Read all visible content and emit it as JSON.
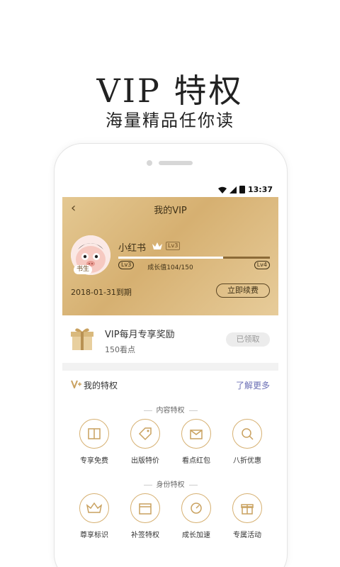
{
  "promo": {
    "title": "VIP 特权",
    "subtitle": "海量精品任你读"
  },
  "status_bar": {
    "time": "13:37"
  },
  "header": {
    "title": "我的VIP",
    "back_icon": "chevron-left-icon"
  },
  "profile": {
    "username": "小红书",
    "avatar_badge": "书生",
    "level_tag": "Lv3",
    "level_current": "Lv3",
    "level_next": "Lv4",
    "growth_text": "成长值104/150",
    "growth_value": 104,
    "growth_max": 150,
    "expire_text": "2018-01-31到期",
    "renew_label": "立即续费"
  },
  "reward": {
    "title": "VIP每月专享奖励",
    "subtitle": "150看点",
    "button_label": "已领取"
  },
  "perks": {
    "title": "我的特权",
    "learn_more": "了解更多",
    "sections": [
      {
        "label": "内容特权",
        "items": [
          {
            "label": "专享免费",
            "icon": "book-icon"
          },
          {
            "label": "出版特价",
            "icon": "price-tag-icon"
          },
          {
            "label": "看点红包",
            "icon": "envelope-icon"
          },
          {
            "label": "八折优惠",
            "icon": "discount-icon"
          }
        ]
      },
      {
        "label": "身份特权",
        "items": [
          {
            "label": "尊享标识",
            "icon": "vip-crown-icon"
          },
          {
            "label": "补签特权",
            "icon": "calendar-icon"
          },
          {
            "label": "成长加速",
            "icon": "speed-icon"
          },
          {
            "label": "专属活动",
            "icon": "gift-icon"
          }
        ]
      }
    ]
  },
  "colors": {
    "gold": "#d6b071",
    "link": "#6b6fb5"
  }
}
